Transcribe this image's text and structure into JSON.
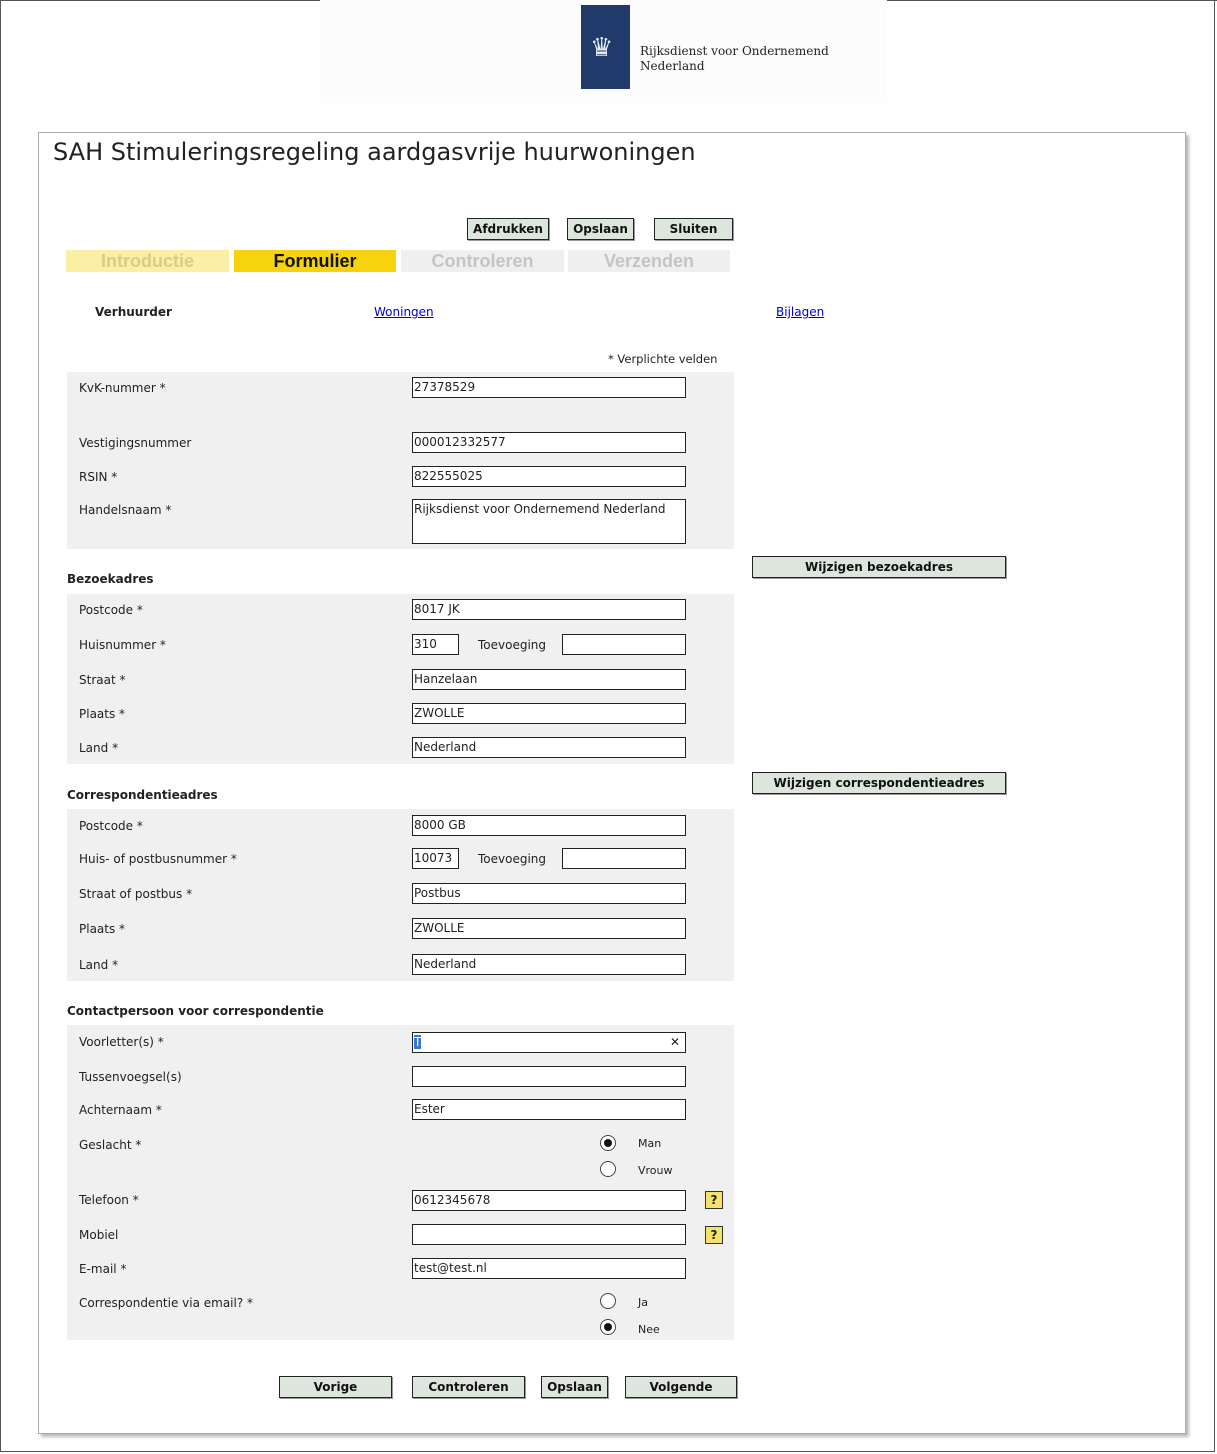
{
  "brand": {
    "org_line1": "Rijksdienst voor Ondernemend",
    "org_line2": "Nederland",
    "logo_color": "#1f3a6b"
  },
  "title": "SAH Stimuleringsregeling aardgasvrije huurwoningen",
  "top_buttons": {
    "print": "Afdrukken",
    "save": "Opslaan",
    "close": "Sluiten"
  },
  "steps": [
    {
      "label": "Introductie",
      "state": "done"
    },
    {
      "label": "Formulier",
      "state": "active"
    },
    {
      "label": "Controleren",
      "state": "todo"
    },
    {
      "label": "Verzenden",
      "state": "todo"
    }
  ],
  "tabs": {
    "current": "Verhuurder",
    "woningen": "Woningen",
    "bijlagen": "Bijlagen"
  },
  "required_note": "* Verplichte velden",
  "verhuurder": {
    "kvk_label": "KvK-nummer *",
    "kvk_value": "27378529",
    "vestiging_label": "Vestigingsnummer",
    "vestiging_value": "000012332577",
    "rsin_label": "RSIN *",
    "rsin_value": "822555025",
    "handelsnaam_label": "Handelsnaam *",
    "handelsnaam_value": "Rijksdienst voor Ondernemend Nederland"
  },
  "bezoekadres": {
    "heading": "Bezoekadres",
    "change_button": "Wijzigen bezoekadres",
    "postcode_label": "Postcode *",
    "postcode_value": "8017 JK",
    "huisnummer_label": "Huisnummer *",
    "huisnummer_value": "310",
    "toevoeging_label": "Toevoeging",
    "toevoeging_value": "",
    "straat_label": "Straat *",
    "straat_value": "Hanzelaan",
    "plaats_label": "Plaats *",
    "plaats_value": "ZWOLLE",
    "land_label": "Land *",
    "land_value": "Nederland"
  },
  "correspondentieadres": {
    "heading": "Correspondentieadres",
    "change_button": "Wijzigen correspondentieadres",
    "postcode_label": "Postcode *",
    "postcode_value": "8000 GB",
    "huisnummer_label": "Huis- of postbusnummer *",
    "huisnummer_value": "10073",
    "toevoeging_label": "Toevoeging",
    "toevoeging_value": "",
    "straat_label": "Straat of postbus *",
    "straat_value": "Postbus",
    "plaats_label": "Plaats *",
    "plaats_value": "ZWOLLE",
    "land_label": "Land *",
    "land_value": "Nederland"
  },
  "contact": {
    "heading": "Contactpersoon voor correspondentie",
    "voorletters_label": "Voorletter(s) *",
    "voorletters_value": "T",
    "tussenvoegsel_label": "Tussenvoegsel(s)",
    "tussenvoegsel_value": "",
    "achternaam_label": "Achternaam *",
    "achternaam_value": "Ester",
    "geslacht_label": "Geslacht *",
    "geslacht_man": "Man",
    "geslacht_vrouw": "Vrouw",
    "geslacht_selected": "Man",
    "telefoon_label": "Telefoon *",
    "telefoon_value": "0612345678",
    "mobiel_label": "Mobiel",
    "mobiel_value": "",
    "email_label": "E-mail *",
    "email_value": "test@test.nl",
    "via_email_label": "Correspondentie via email? *",
    "via_email_ja": "Ja",
    "via_email_nee": "Nee",
    "via_email_selected": "Nee",
    "help_glyph": "?",
    "clear_glyph": "✕"
  },
  "bottom_buttons": {
    "prev": "Vorige",
    "check": "Controleren",
    "save": "Opslaan",
    "next": "Volgende"
  }
}
